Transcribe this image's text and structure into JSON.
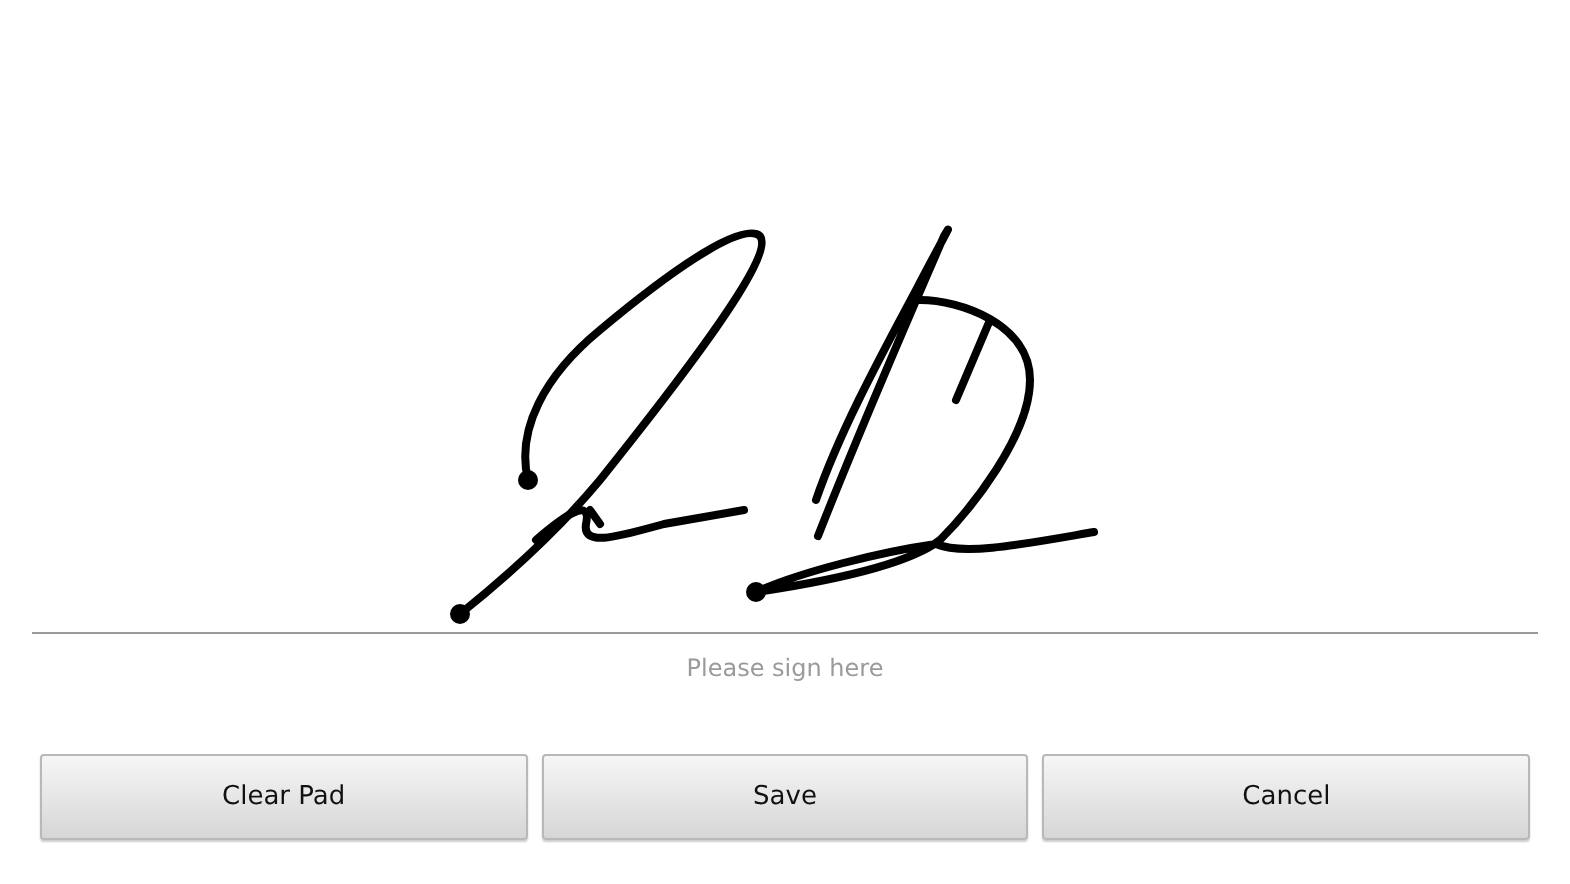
{
  "signature_pad": {
    "placeholder": "Please sign here"
  },
  "buttons": [
    {
      "label": "Clear Pad"
    },
    {
      "label": "Save"
    },
    {
      "label": "Cancel"
    }
  ]
}
